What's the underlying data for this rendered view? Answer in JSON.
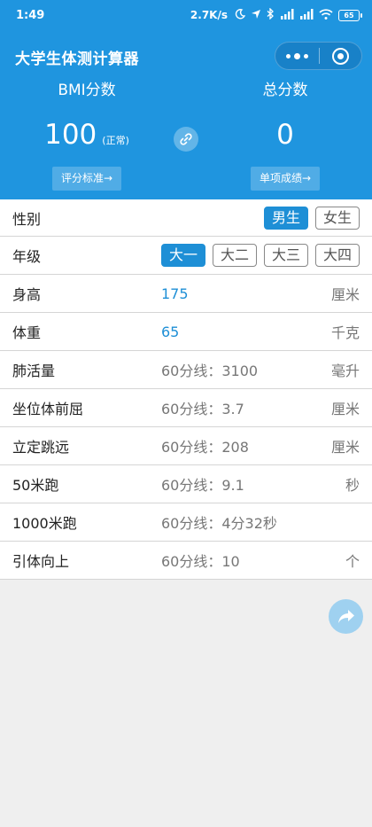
{
  "status_bar": {
    "time": "1:49",
    "net_speed": "2.7K/s",
    "battery": "65"
  },
  "title_bar": {
    "title": "大学生体测计算器"
  },
  "scores": {
    "bmi": {
      "label": "BMI分数",
      "value": "100",
      "status": "(正常)",
      "button": "评分标准→"
    },
    "total": {
      "label": "总分数",
      "value": "0",
      "button": "单项成绩→"
    }
  },
  "form": {
    "gender": {
      "label": "性别",
      "options": [
        "男生",
        "女生"
      ],
      "selected": "男生"
    },
    "grade": {
      "label": "年级",
      "options": [
        "大一",
        "大二",
        "大三",
        "大四"
      ],
      "selected": "大一"
    },
    "items": [
      {
        "label": "身高",
        "value": "175",
        "unit": "厘米"
      },
      {
        "label": "体重",
        "value": "65",
        "unit": "千克"
      },
      {
        "label": "肺活量",
        "value": "60分线：3100",
        "unit": "毫升"
      },
      {
        "label": "坐位体前屈",
        "value": "60分线：3.7",
        "unit": "厘米"
      },
      {
        "label": "立定跳远",
        "value": "60分线：208",
        "unit": "厘米"
      },
      {
        "label": "50米跑",
        "value": "60分线：9.1",
        "unit": "秒"
      },
      {
        "label": "1000米跑",
        "value": "60分线：4分32秒",
        "unit": ""
      },
      {
        "label": "引体向上",
        "value": "60分线：10",
        "unit": "个"
      }
    ]
  },
  "colors": {
    "header_bg": "#1f95df",
    "accent": "#1e8fd6",
    "page_bg": "#efefef"
  },
  "icons": {
    "link": "link-icon",
    "share": "share-icon",
    "more": "more-dots-icon",
    "close": "close-miniprogram-icon"
  }
}
